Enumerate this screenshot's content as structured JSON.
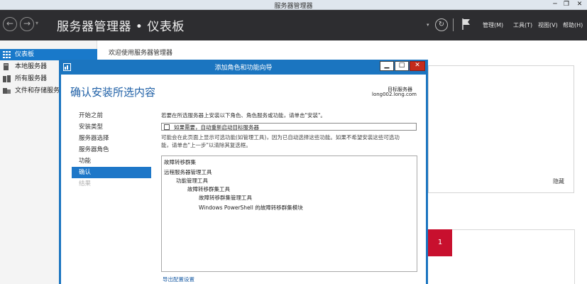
{
  "window": {
    "title": "服务器管理器",
    "min_label": "─",
    "max_label": "❐",
    "close_label": "✕"
  },
  "header": {
    "back_glyph": "←",
    "forward_glyph": "→",
    "title": "服务器管理器 • 仪表板",
    "menus": [
      "管理(M)",
      "工具(T)",
      "视图(V)",
      "帮助(H)"
    ]
  },
  "sidebar": {
    "items": [
      {
        "label": "仪表板",
        "icon": "dashboard-icon"
      },
      {
        "label": "本地服务器",
        "icon": "server-icon"
      },
      {
        "label": "所有服务器",
        "icon": "servers-icon"
      },
      {
        "label": "文件和存储服务",
        "icon": "folder-icon"
      }
    ]
  },
  "background": {
    "welcome": "欢迎使用服务器管理器",
    "hide_label": "隐藏",
    "tile_count": "1"
  },
  "wizard": {
    "title": "添加角色和功能向导",
    "heading": "确认安装所选内容",
    "target_label": "目标服务器",
    "target_server": "long002.long.com",
    "steps": [
      {
        "label": "开始之前",
        "state": "normal"
      },
      {
        "label": "安装类型",
        "state": "normal"
      },
      {
        "label": "服务器选择",
        "state": "normal"
      },
      {
        "label": "服务器角色",
        "state": "normal"
      },
      {
        "label": "功能",
        "state": "normal"
      },
      {
        "label": "确认",
        "state": "active"
      },
      {
        "label": "结果",
        "state": "disabled"
      }
    ],
    "intro": "若要在所选服务器上安装以下角色、角色服务或功能，请单击\"安装\"。",
    "restart_label": "如果需要，自动重新启动目标服务器",
    "restart_checked": false,
    "note_line1": "可能会在此页面上显示可选功能(如管理工具)，因为已自动选择这些功能。如果不希望安装这些可选功",
    "note_line2": "能，请单击\"上一步\"以清除其复选框。",
    "features": [
      {
        "label": "故障转移群集",
        "level": 0
      },
      {
        "label": "远程服务器管理工具",
        "level": 0
      },
      {
        "label": "功能管理工具",
        "level": 1
      },
      {
        "label": "故障转移群集工具",
        "level": 2
      },
      {
        "label": "故障转移群集管理工具",
        "level": 3
      },
      {
        "label": "Windows PowerShell 的故障转移群集模块",
        "level": 3
      }
    ],
    "export_link": "导出配置设置"
  },
  "colors": {
    "header_bg": "#2d2d30",
    "accent": "#1979ca",
    "wizard_frame": "#1b75c0",
    "alert_red": "#c8102e"
  }
}
